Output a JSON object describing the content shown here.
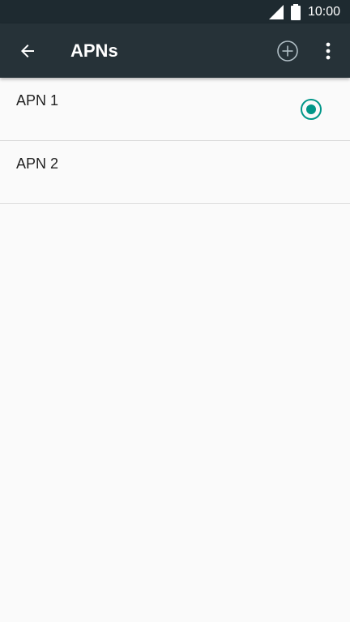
{
  "status_bar": {
    "time": "10:00",
    "signal_icon": "signal-icon",
    "battery_icon": "battery-icon"
  },
  "app_bar": {
    "back_icon": "arrow-back-icon",
    "title": "APNs",
    "add_icon": "add-circle-icon",
    "more_icon": "more-vert-icon"
  },
  "apns": [
    {
      "name": "APN 1",
      "selected": true
    },
    {
      "name": "APN 2",
      "selected": false
    }
  ],
  "colors": {
    "status_bar_bg": "#1e2a30",
    "app_bar_bg": "#263238",
    "accent": "#009688",
    "background": "#fafafa"
  }
}
